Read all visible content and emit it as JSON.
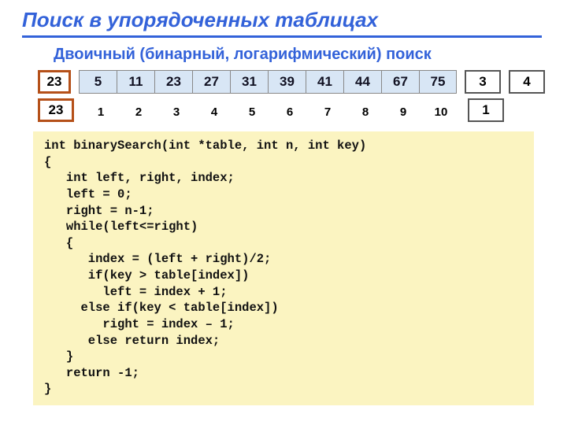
{
  "title": "Поиск в упорядоченных таблицах",
  "subtitle": "Двоичный (бинарный, логарифмический) поиск",
  "key_top": "23",
  "key_bottom": "23",
  "array": [
    "5",
    "11",
    "23",
    "27",
    "31",
    "39",
    "41",
    "44",
    "67",
    "75"
  ],
  "indices": [
    "1",
    "2",
    "3",
    "4",
    "5",
    "6",
    "7",
    "8",
    "9",
    "10"
  ],
  "right_top_a": "3",
  "right_top_b": "4",
  "right_bottom": "1",
  "code": "int binarySearch(int *table, int n, int key)\n{\n   int left, right, index;\n   left = 0;\n   right = n-1;\n   while(left<=right)\n   {\n      index = (left + right)/2;\n      if(key > table[index])\n        left = index + 1;\n     else if(key < table[index])\n        right = index – 1;\n      else return index;\n   }\n   return -1;\n}"
}
